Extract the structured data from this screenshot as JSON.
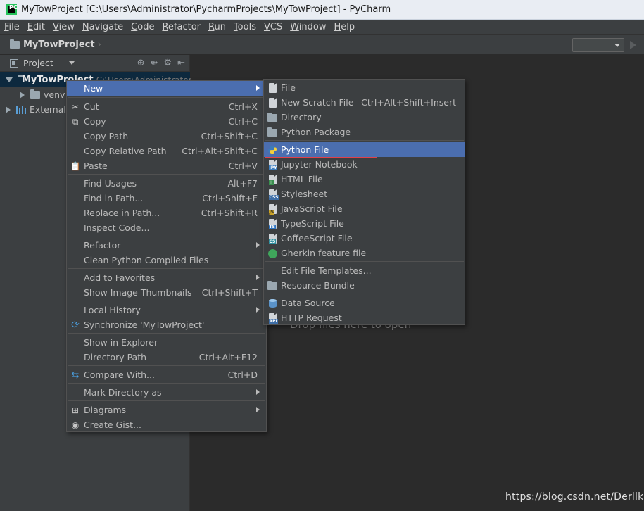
{
  "window": {
    "title": "MyTowProject [C:\\Users\\Administrator\\PycharmProjects\\MyTowProject] - PyCharm"
  },
  "menubar": [
    {
      "label": "File",
      "u": "F",
      "rest": "ile"
    },
    {
      "label": "Edit",
      "u": "E",
      "rest": "dit"
    },
    {
      "label": "View",
      "u": "V",
      "rest": "iew"
    },
    {
      "label": "Navigate",
      "u": "N",
      "rest": "avigate"
    },
    {
      "label": "Code",
      "u": "C",
      "rest": "ode"
    },
    {
      "label": "Refactor",
      "u": "R",
      "rest": "efactor"
    },
    {
      "label": "Run",
      "u": "R",
      "rest": "un"
    },
    {
      "label": "Tools",
      "u": "T",
      "rest": "ools"
    },
    {
      "label": "VCS",
      "u": "V",
      "rest": "CS"
    },
    {
      "label": "Window",
      "u": "W",
      "rest": "indow"
    },
    {
      "label": "Help",
      "u": "H",
      "rest": "elp"
    }
  ],
  "navbar": {
    "breadcrumb": "MyTowProject"
  },
  "project_panel": {
    "title": "Project",
    "root_label": "MyTowProject",
    "root_path": "C:\\Users\\Administrator",
    "venv_label": "venv",
    "external_label": "External"
  },
  "editor": {
    "drop_hint": "Drop files here to open"
  },
  "watermark": "https://blog.csdn.net/Derllk",
  "context_menu": {
    "new": "New",
    "cut": "Cut",
    "cut_sc": "Ctrl+X",
    "copy": "Copy",
    "copy_sc": "Ctrl+C",
    "copy_path": "Copy Path",
    "copy_path_sc": "Ctrl+Shift+C",
    "copy_rel": "Copy Relative Path",
    "copy_rel_sc": "Ctrl+Alt+Shift+C",
    "paste": "Paste",
    "paste_sc": "Ctrl+V",
    "find_usages": "Find Usages",
    "find_usages_sc": "Alt+F7",
    "find_in_path": "Find in Path...",
    "find_in_path_sc": "Ctrl+Shift+F",
    "replace_in_path": "Replace in Path...",
    "replace_in_path_sc": "Ctrl+Shift+R",
    "inspect": "Inspect Code...",
    "refactor": "Refactor",
    "clean": "Clean Python Compiled Files",
    "add_fav": "Add to Favorites",
    "thumbnails": "Show Image Thumbnails",
    "thumbnails_sc": "Ctrl+Shift+T",
    "local_history": "Local History",
    "sync": "Synchronize 'MyTowProject'",
    "show_explorer": "Show in Explorer",
    "dir_path": "Directory Path",
    "dir_path_sc": "Ctrl+Alt+F12",
    "compare": "Compare With...",
    "compare_sc": "Ctrl+D",
    "mark_dir": "Mark Directory as",
    "diagrams": "Diagrams",
    "gist": "Create Gist..."
  },
  "new_submenu": {
    "file": "File",
    "scratch": "New Scratch File",
    "scratch_sc": "Ctrl+Alt+Shift+Insert",
    "directory": "Directory",
    "package": "Python Package",
    "python_file": "Python File",
    "jupyter": "Jupyter Notebook",
    "html": "HTML File",
    "stylesheet": "Stylesheet",
    "javascript": "JavaScript File",
    "typescript": "TypeScript File",
    "coffeescript": "CoffeeScript File",
    "gherkin": "Gherkin feature file",
    "templates": "Edit File Templates...",
    "bundle": "Resource Bundle",
    "datasource": "Data Source",
    "http": "HTTP Request"
  },
  "colors": {
    "selection": "#4b6eaf",
    "highlight_box": "#e0404a",
    "panel_bg": "#3c3f41",
    "editor_bg": "#2b2b2b"
  }
}
